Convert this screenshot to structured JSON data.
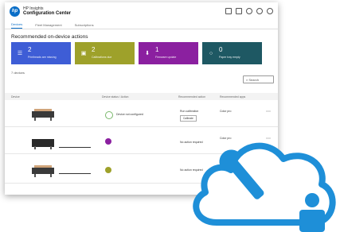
{
  "app": {
    "title_line1": "HP Insights",
    "title_line2": "Configuration Center"
  },
  "tabs": [
    "Devices",
    "Fleet Management",
    "Subscriptions"
  ],
  "section_title": "Recommended on-device actions",
  "cards": [
    {
      "num": "2",
      "label": "Printheads are missing"
    },
    {
      "num": "2",
      "label": "Calibrations due"
    },
    {
      "num": "1",
      "label": "Firmware update"
    },
    {
      "num": "0",
      "label": "Paper tray empty"
    }
  ],
  "device_count": "7 devices",
  "search_placeholder": "Search",
  "table": {
    "headers": [
      "Device",
      "Device status / Action",
      "Recommended action",
      "Recommended apps"
    ],
    "rows": [
      {
        "status": "Device not configured",
        "recom": "Run calibration",
        "btn": "Calibrate",
        "app": "Color pro"
      },
      {
        "status": "",
        "recom": "No action required",
        "btn": "",
        "app": "Color pro"
      },
      {
        "status": "",
        "recom": "No action required",
        "btn": "",
        "app": ""
      }
    ]
  },
  "colors": {
    "accent": "#0a6ec7",
    "cloud": "#1e8fd8"
  }
}
